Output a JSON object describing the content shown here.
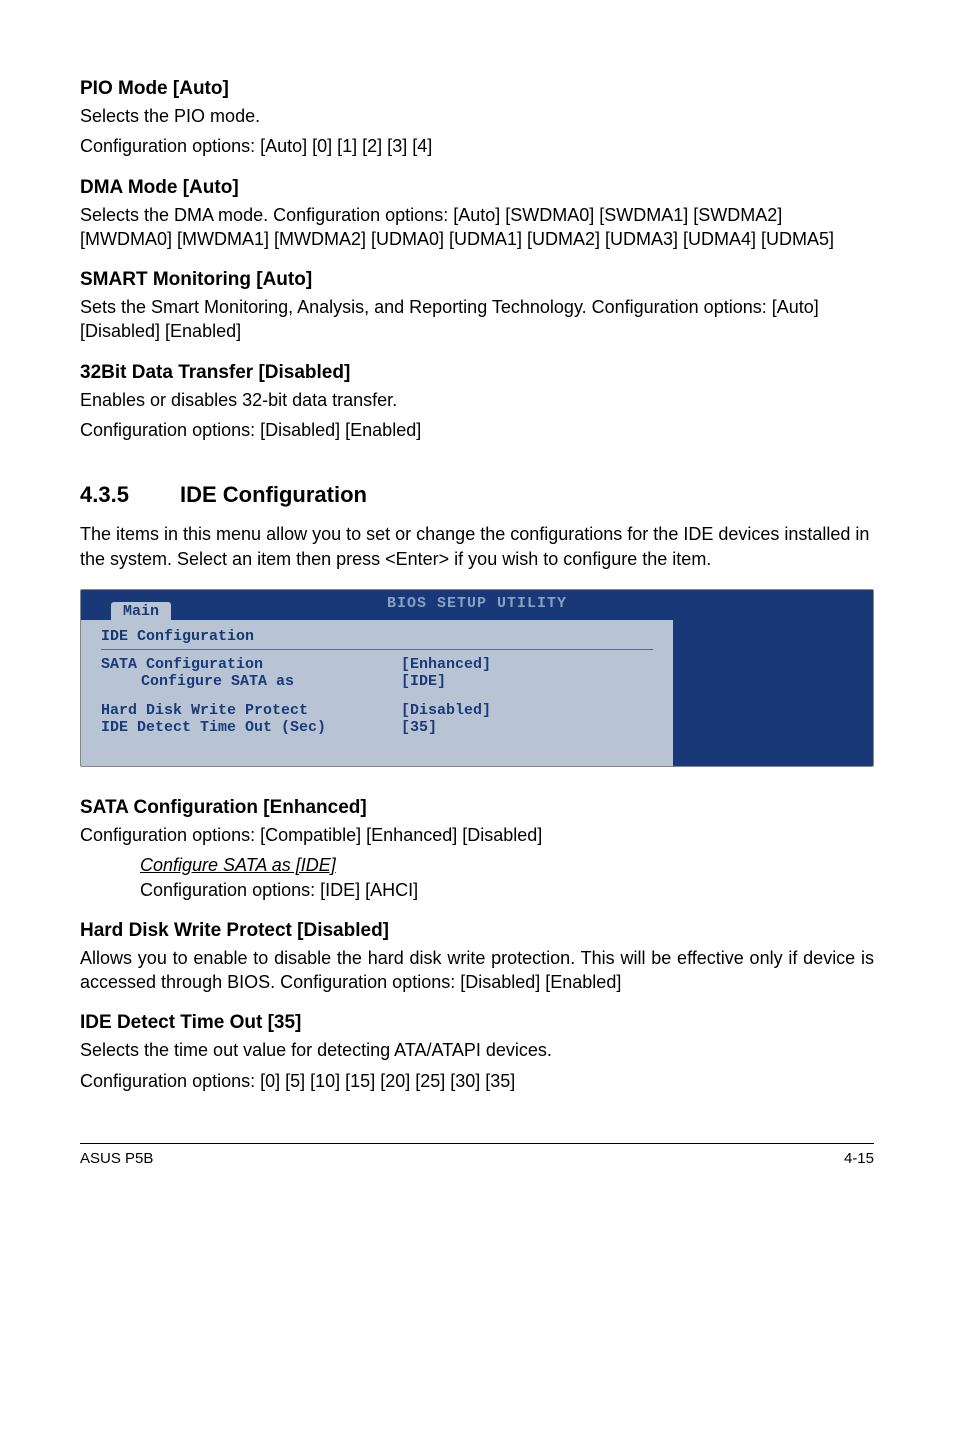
{
  "sections": {
    "pio": {
      "title": "PIO Mode [Auto]",
      "line1": "Selects the PIO mode.",
      "line2": "Configuration options: [Auto] [0] [1] [2] [3] [4]"
    },
    "dma": {
      "title": "DMA Mode [Auto]",
      "body": "Selects the DMA mode. Configuration options: [Auto] [SWDMA0] [SWDMA1] [SWDMA2] [MWDMA0] [MWDMA1] [MWDMA2] [UDMA0] [UDMA1] [UDMA2] [UDMA3] [UDMA4] [UDMA5]"
    },
    "smart": {
      "title": "SMART Monitoring [Auto]",
      "body": "Sets the Smart Monitoring, Analysis, and Reporting Technology. Configuration options: [Auto] [Disabled] [Enabled]"
    },
    "bit32": {
      "title": "32Bit Data Transfer [Disabled]",
      "line1": "Enables or disables 32-bit data transfer.",
      "line2": "Configuration options: [Disabled] [Enabled]"
    }
  },
  "ide_heading": {
    "num": "4.3.5",
    "title": "IDE Configuration",
    "intro": "The items in this menu allow you to set or change the configurations for the IDE devices installed in the system. Select an item then press <Enter> if you wish to configure the item."
  },
  "bios": {
    "header": "BIOS SETUP UTILITY",
    "tab": "Main",
    "group": "IDE Configuration",
    "rows": {
      "sata_conf_label": "SATA Configuration",
      "sata_conf_value": "[Enhanced]",
      "configure_as_label": "Configure SATA as",
      "configure_as_value": "[IDE]",
      "hdwp_label": "Hard Disk Write Protect",
      "hdwp_value": "[Disabled]",
      "ide_detect_label": "IDE Detect Time Out (Sec)",
      "ide_detect_value": "[35]"
    }
  },
  "sata": {
    "title": "SATA Configuration [Enhanced]",
    "body": "Configuration options: [Compatible] [Enhanced] [Disabled]",
    "sub_title": "Configure SATA as [IDE]",
    "sub_body": "Configuration options: [IDE] [AHCI]"
  },
  "hdwp": {
    "title": "Hard Disk Write Protect [Disabled]",
    "body": "Allows you to enable to disable the hard disk write protection. This will be effective only if device is accessed through BIOS. Configuration options: [Disabled] [Enabled]"
  },
  "detect": {
    "title": "IDE Detect Time Out [35]",
    "line1": "Selects the time out value for detecting ATA/ATAPI devices.",
    "line2": "Configuration options: [0] [5] [10] [15] [20] [25] [30] [35]"
  },
  "footer": {
    "left": "ASUS P5B",
    "right": "4-15"
  }
}
